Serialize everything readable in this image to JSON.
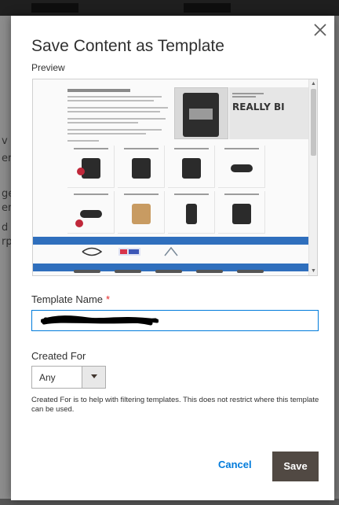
{
  "backdrop": {
    "fragments": [
      "v",
      "er",
      "ge",
      "en",
      "d",
      "rp"
    ]
  },
  "modal": {
    "title": "Save Content as Template",
    "preview_label": "Preview",
    "preview": {
      "hero_text": "REALLY BI"
    },
    "template_name": {
      "label": "Template Name",
      "required_mark": "*",
      "value": ""
    },
    "created_for": {
      "label": "Created For",
      "selected": "Any",
      "note": "Created For is to help with filtering templates. This does not restrict where this template can be used."
    },
    "actions": {
      "cancel": "Cancel",
      "save": "Save"
    }
  },
  "colors": {
    "accent": "#007bdb",
    "save_button": "#514943",
    "required": "#e22626"
  }
}
